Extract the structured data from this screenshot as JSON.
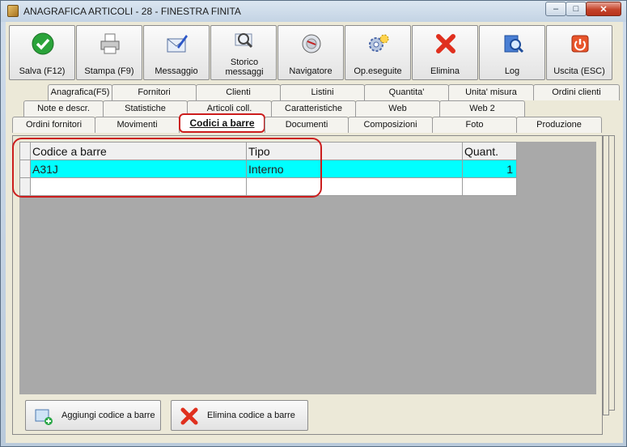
{
  "window": {
    "title": "ANAGRAFICA ARTICOLI - 28 - FINESTRA FINITA"
  },
  "toolbar": [
    {
      "label": "Salva (F12)",
      "icon": "check-icon"
    },
    {
      "label": "Stampa (F9)",
      "icon": "printer-icon"
    },
    {
      "label": "Messaggio",
      "icon": "envelope-pen-icon"
    },
    {
      "label": "Storico messaggi",
      "icon": "message-history-icon"
    },
    {
      "label": "Navigatore",
      "icon": "navigator-icon"
    },
    {
      "label": "Op.eseguite",
      "icon": "gears-icon"
    },
    {
      "label": "Elimina",
      "icon": "delete-x-icon"
    },
    {
      "label": "Log",
      "icon": "log-icon"
    },
    {
      "label": "Uscita (ESC)",
      "icon": "exit-icon"
    }
  ],
  "tabs": {
    "row1": [
      "Anagrafica(F5)",
      "Fornitori",
      "Clienti",
      "Listini",
      "Quantita'",
      "Unita' misura",
      "Ordini clienti"
    ],
    "row2": [
      "Note e descr.",
      "Statistiche",
      "Articoli coll.",
      "Caratteristiche",
      "Web",
      "Web 2"
    ],
    "row3": [
      "Ordini fornitori",
      "Movimenti",
      "Codici a barre",
      "Documenti",
      "Composizioni",
      "Foto",
      "Produzione"
    ],
    "active": "Codici a barre"
  },
  "grid": {
    "headers": [
      "Codice a barre",
      "Tipo",
      "Quant."
    ],
    "rows": [
      {
        "code": "A31J",
        "tipo": "Interno",
        "quant": "1",
        "selected": true
      },
      {
        "code": "",
        "tipo": "",
        "quant": ""
      }
    ]
  },
  "buttons": {
    "add": "Aggiungi codice a barre",
    "delete": "Elimina codice a barre"
  },
  "colors": {
    "selected_row": "#00ffff",
    "highlight": "#cc1d1d",
    "grid_bg": "#a9a9a9"
  }
}
